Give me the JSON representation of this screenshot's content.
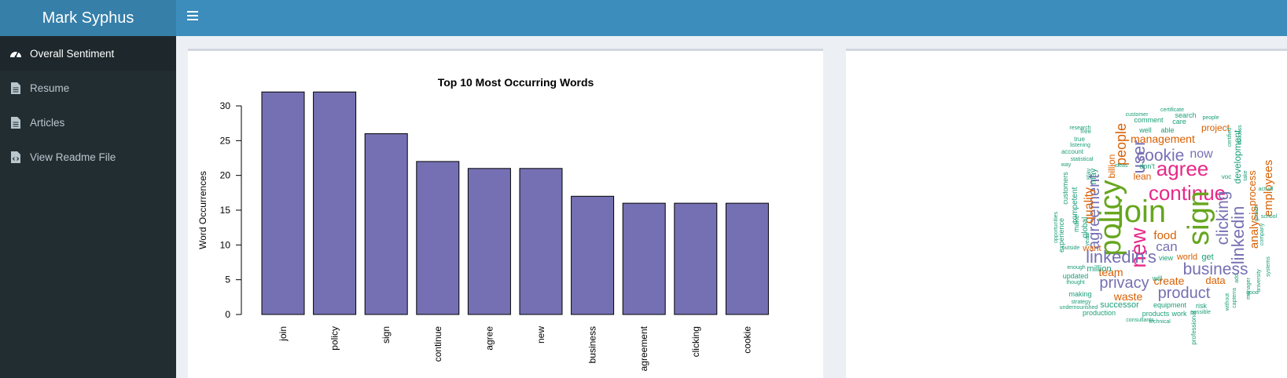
{
  "header": {
    "brand": "Mark Syphus"
  },
  "sidebar": {
    "items": [
      {
        "label": "Overall Sentiment",
        "icon": "dashboard-icon",
        "active": true
      },
      {
        "label": "Resume",
        "icon": "file-icon",
        "active": false
      },
      {
        "label": "Articles",
        "icon": "file-icon",
        "active": false
      },
      {
        "label": "View Readme File",
        "icon": "code-file-icon",
        "active": false
      }
    ]
  },
  "colors": {
    "bar_fill": "#7570b3",
    "navbar": "#3c8dbc",
    "logo_bg": "#367fa9",
    "sidebar": "#222d32"
  },
  "chart_data": {
    "type": "bar",
    "title": "Top 10 Most Occurring Words",
    "xlabel": "",
    "ylabel": "Word Occurrences",
    "categories": [
      "join",
      "policy",
      "sign",
      "continue",
      "agree",
      "new",
      "business",
      "agreement",
      "clicking",
      "cookie"
    ],
    "values": [
      32,
      32,
      26,
      22,
      21,
      21,
      17,
      16,
      16,
      16
    ],
    "ylim": [
      0,
      30
    ],
    "yticks": [
      0,
      5,
      10,
      15,
      20,
      25,
      30
    ],
    "grid": false
  },
  "wordcloud": {
    "words": [
      {
        "text": "policy",
        "color": "#66a61e"
      },
      {
        "text": "join",
        "color": "#66a61e"
      },
      {
        "text": "continue",
        "color": "#e7298a"
      },
      {
        "text": "sign",
        "color": "#66a61e"
      },
      {
        "text": "agree",
        "color": "#e7298a"
      },
      {
        "text": "new",
        "color": "#e7298a"
      },
      {
        "text": "business",
        "color": "#7570b3"
      },
      {
        "text": "agreement",
        "color": "#7570b3"
      },
      {
        "text": "clicking",
        "color": "#7570b3"
      },
      {
        "text": "cookie",
        "color": "#7570b3"
      },
      {
        "text": "linkedin's",
        "color": "#7570b3"
      },
      {
        "text": "linkedin",
        "color": "#7570b3"
      },
      {
        "text": "privacy",
        "color": "#7570b3"
      },
      {
        "text": "product",
        "color": "#7570b3"
      },
      {
        "text": "user",
        "color": "#7570b3"
      },
      {
        "text": "people",
        "color": "#d95f02"
      },
      {
        "text": "management",
        "color": "#d95f02"
      },
      {
        "text": "now",
        "color": "#7570b3"
      },
      {
        "text": "quality",
        "color": "#d95f02"
      },
      {
        "text": "analysis",
        "color": "#d95f02"
      },
      {
        "text": "employees",
        "color": "#d95f02"
      },
      {
        "text": "process",
        "color": "#d95f02"
      },
      {
        "text": "can",
        "color": "#7570b3"
      },
      {
        "text": "food",
        "color": "#d95f02"
      },
      {
        "text": "team",
        "color": "#d95f02"
      },
      {
        "text": "create",
        "color": "#d95f02"
      },
      {
        "text": "waste",
        "color": "#d95f02"
      },
      {
        "text": "data",
        "color": "#d95f02"
      },
      {
        "text": "billion",
        "color": "#d95f02"
      },
      {
        "text": "development",
        "color": "#1b9e77"
      },
      {
        "text": "project",
        "color": "#d95f02"
      },
      {
        "text": "lean",
        "color": "#d95f02"
      },
      {
        "text": "want",
        "color": "#d95f02"
      },
      {
        "text": "million",
        "color": "#1b9e77"
      },
      {
        "text": "successor",
        "color": "#1b9e77"
      },
      {
        "text": "world",
        "color": "#d95f02"
      },
      {
        "text": "get",
        "color": "#1b9e77"
      },
      {
        "text": "may",
        "color": "#1b9e77"
      },
      {
        "text": "global",
        "color": "#1b9e77"
      },
      {
        "text": "competent",
        "color": "#1b9e77"
      },
      {
        "text": "customers",
        "color": "#1b9e77"
      },
      {
        "text": "experience",
        "color": "#1b9e77"
      },
      {
        "text": "make",
        "color": "#1b9e77"
      },
      {
        "text": "updated",
        "color": "#1b9e77"
      },
      {
        "text": "making",
        "color": "#1b9e77"
      },
      {
        "text": "production",
        "color": "#1b9e77"
      },
      {
        "text": "products",
        "color": "#1b9e77"
      },
      {
        "text": "work",
        "color": "#1b9e77"
      },
      {
        "text": "equipment",
        "color": "#1b9e77"
      },
      {
        "text": "risk",
        "color": "#1b9e77"
      },
      {
        "text": "view",
        "color": "#1b9e77"
      },
      {
        "text": "will",
        "color": "#1b9e77"
      },
      {
        "text": "don't",
        "color": "#1b9e77"
      },
      {
        "text": "well",
        "color": "#1b9e77"
      },
      {
        "text": "able",
        "color": "#1b9e77"
      },
      {
        "text": "care",
        "color": "#1b9e77"
      },
      {
        "text": "search",
        "color": "#1b9e77"
      },
      {
        "text": "comment",
        "color": "#1b9e77"
      },
      {
        "text": "account",
        "color": "#1b9e77"
      },
      {
        "text": "true",
        "color": "#1b9e77"
      },
      {
        "text": "free",
        "color": "#1b9e77"
      },
      {
        "text": "research",
        "color": "#1b9e77"
      },
      {
        "text": "customer",
        "color": "#1b9e77"
      },
      {
        "text": "certificate",
        "color": "#1b9e77"
      },
      {
        "text": "people",
        "color": "#1b9e77"
      },
      {
        "text": "professional",
        "color": "#1b9e77"
      },
      {
        "text": "without",
        "color": "#1b9e77"
      },
      {
        "text": "add",
        "color": "#1b9e77"
      },
      {
        "text": "manager",
        "color": "#1b9e77"
      },
      {
        "text": "university",
        "color": "#1b9e77"
      },
      {
        "text": "systems",
        "color": "#1b9e77"
      },
      {
        "text": "growth",
        "color": "#1b9e77"
      },
      {
        "text": "school",
        "color": "#1b9e77"
      },
      {
        "text": "actual",
        "color": "#1b9e77"
      },
      {
        "text": "take",
        "color": "#1b9e77"
      },
      {
        "text": "voc",
        "color": "#1b9e77"
      },
      {
        "text": "years",
        "color": "#1b9e77"
      },
      {
        "text": "enough",
        "color": "#1b9e77"
      },
      {
        "text": "thought",
        "color": "#1b9e77"
      },
      {
        "text": "strategy",
        "color": "#1b9e77"
      },
      {
        "text": "undernourished",
        "color": "#1b9e77"
      },
      {
        "text": "consultants",
        "color": "#1b9e77"
      },
      {
        "text": "technical",
        "color": "#1b9e77"
      },
      {
        "text": "possible",
        "color": "#1b9e77"
      },
      {
        "text": "good",
        "color": "#1b9e77"
      },
      {
        "text": "statistical",
        "color": "#1b9e77"
      },
      {
        "text": "listening",
        "color": "#1b9e77"
      },
      {
        "text": "outside",
        "color": "#1b9e77"
      },
      {
        "text": "opportunities",
        "color": "#1b9e77"
      },
      {
        "text": "ideas",
        "color": "#1b9e77"
      },
      {
        "text": "success",
        "color": "#1b9e77"
      },
      {
        "text": "certified",
        "color": "#1b9e77"
      },
      {
        "text": "capterra",
        "color": "#1b9e77"
      },
      {
        "text": "company",
        "color": "#1b9e77"
      },
      {
        "text": "way",
        "color": "#1b9e77"
      },
      {
        "text": "stay",
        "color": "#1b9e77"
      }
    ]
  }
}
